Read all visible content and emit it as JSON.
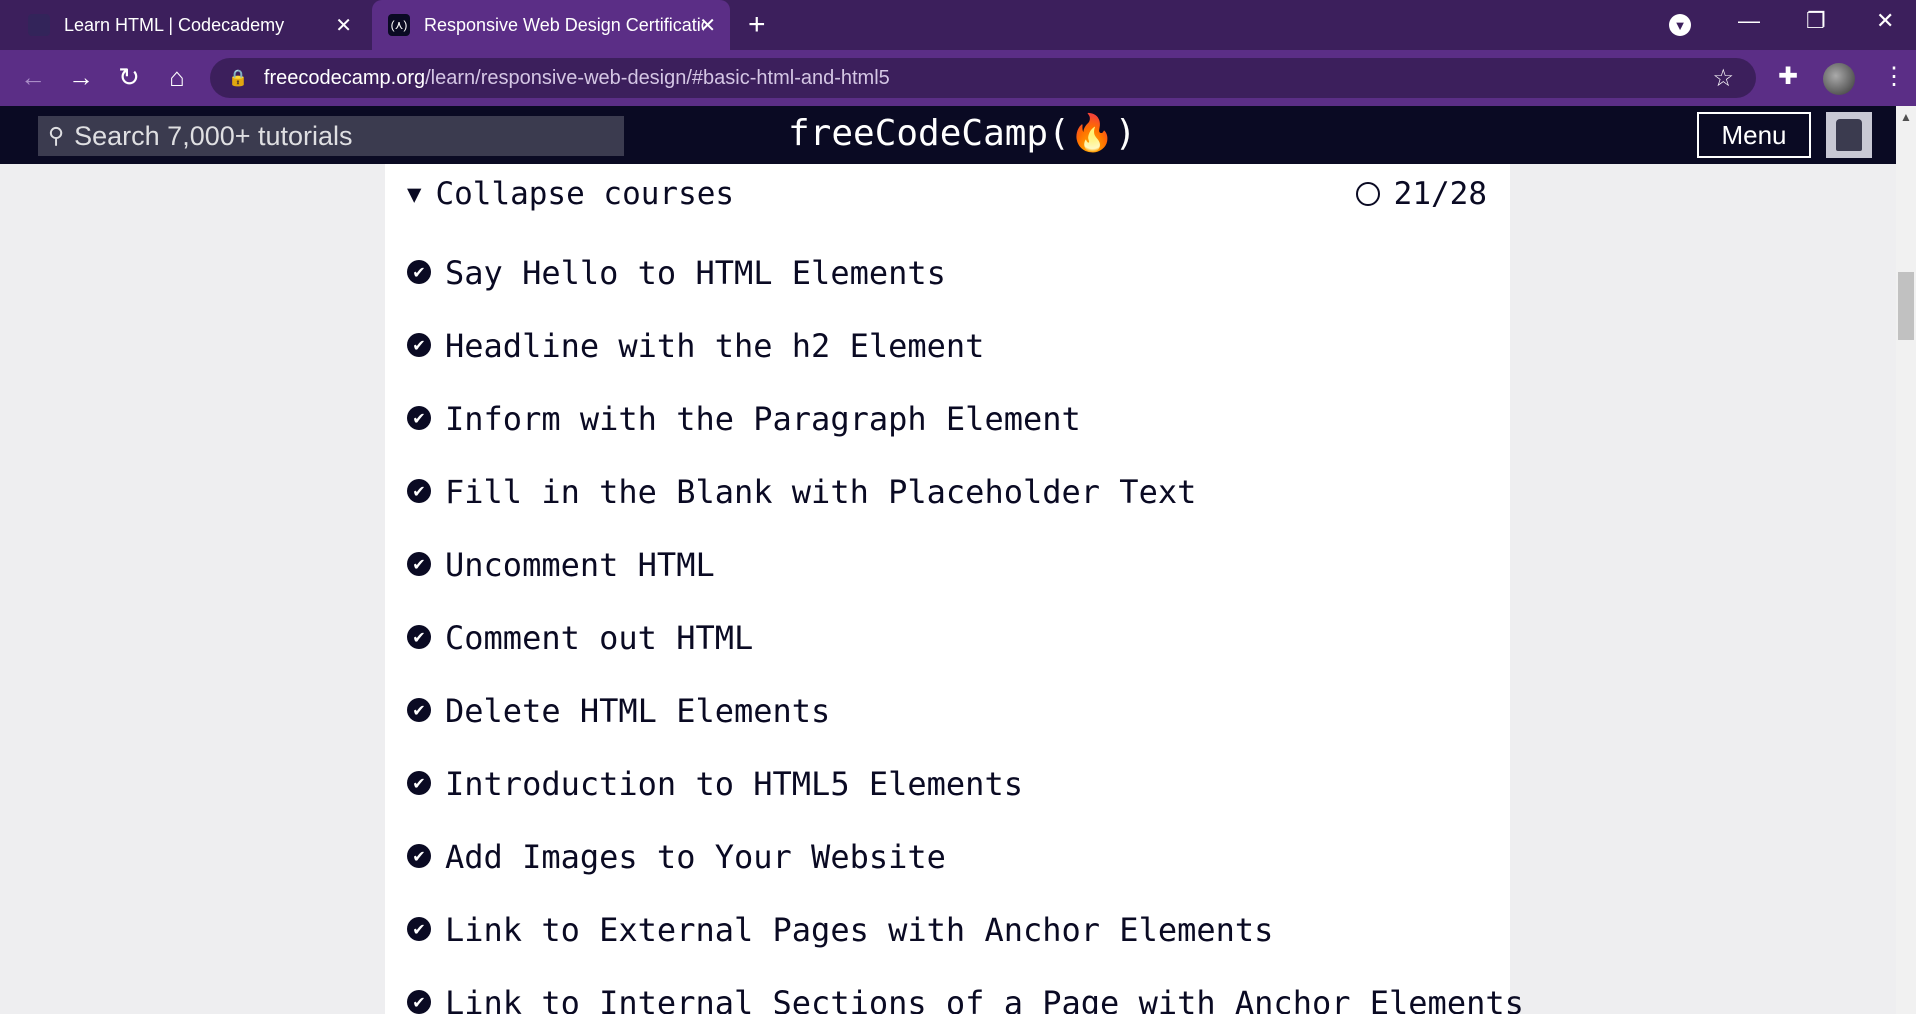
{
  "browser": {
    "tabs": [
      {
        "title": "Learn HTML | Codecademy",
        "active": false
      },
      {
        "title": "Responsive Web Design Certification",
        "active": true
      }
    ],
    "new_tab": "+",
    "window_controls": {
      "minimize": "—",
      "restore": "❐",
      "close": "✕"
    },
    "address": {
      "host": "freecodecamp.org",
      "path": "/learn/responsive-web-design/#basic-html-and-html5"
    },
    "colors": {
      "tabstrip": "#3c1f5c",
      "toolbar": "#5b2e86"
    }
  },
  "fcc_nav": {
    "search_placeholder": "Search 7,000+ tutorials",
    "logo": "freeCodeCamp(🔥)",
    "menu_label": "Menu"
  },
  "course": {
    "collapse_label": "Collapse courses",
    "progress": "21/28",
    "lessons": [
      "Say Hello to HTML Elements",
      "Headline with the h2 Element",
      "Inform with the Paragraph Element",
      "Fill in the Blank with Placeholder Text",
      "Uncomment HTML",
      "Comment out HTML",
      "Delete HTML Elements",
      "Introduction to HTML5 Elements",
      "Add Images to Your Website",
      "Link to External Pages with Anchor Elements",
      "Link to Internal Sections of a Page with Anchor Elements"
    ]
  }
}
